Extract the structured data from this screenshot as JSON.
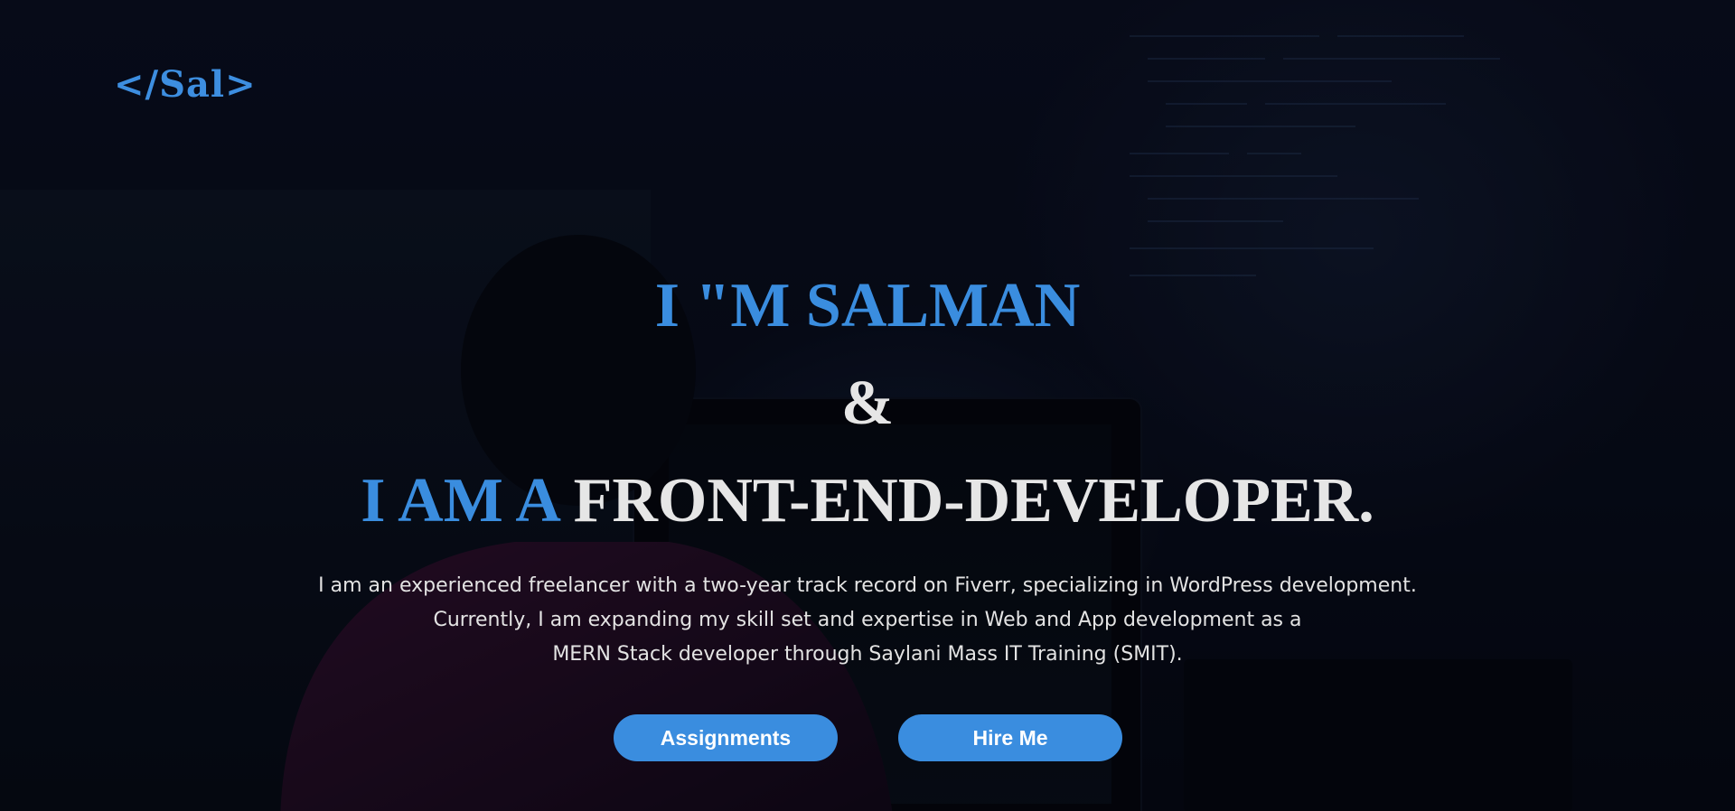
{
  "brand": {
    "logo_text": "</Sal>"
  },
  "hero": {
    "name_line": "I \"M SALMAN",
    "ampersand": "&",
    "role_prefix": "I AM A",
    "role_title": "FRONT-END-DEVELOPER.",
    "intro_lines": [
      "I am an experienced freelancer with a two-year track record on Fiverr, specializing in WordPress development.",
      "Currently, I am expanding my skill set and expertise in Web and App development as a",
      "MERN Stack developer through Saylani Mass IT Training (SMIT)."
    ]
  },
  "actions": {
    "assignments_label": "Assignments",
    "hire_label": "Hire Me"
  },
  "colors": {
    "accent": "#3a8ddf",
    "heading_white": "#e6e6e6",
    "background": "#070b18"
  }
}
